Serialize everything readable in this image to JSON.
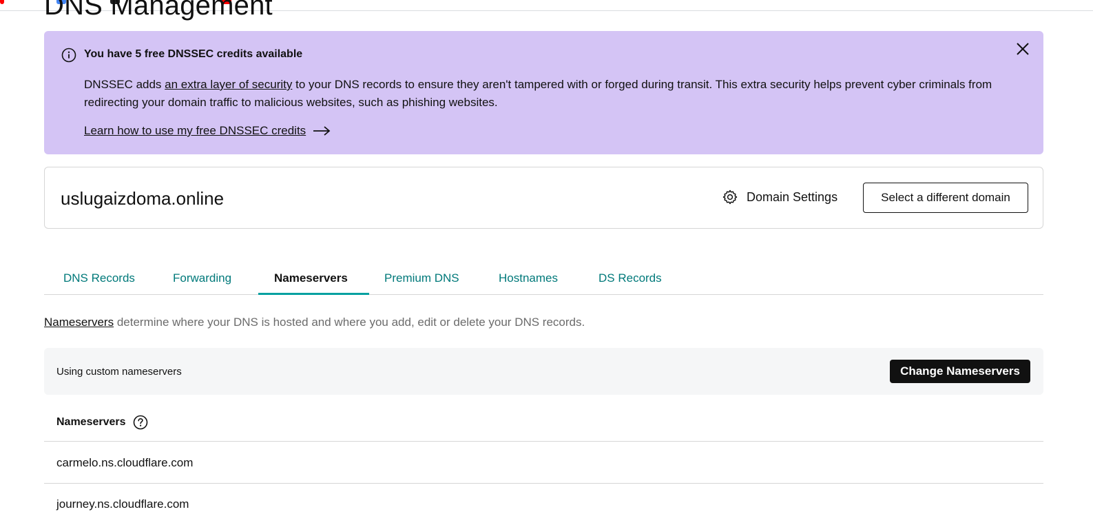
{
  "page": {
    "title": "DNS Management"
  },
  "banner": {
    "title": "You have 5 free DNSSEC credits available",
    "body_prefix": "DNSSEC adds ",
    "body_link": "an extra layer of security",
    "body_suffix": " to your DNS records to ensure they aren't tampered with or forged during transit. This extra security helps prevent cyber criminals from redirecting your domain traffic to malicious websites, such as phishing websites.",
    "cta": "Learn how to use my free DNSSEC credits",
    "background_color": "#d4c4f5"
  },
  "domain": {
    "name": "uslugaizdoma.online",
    "settings_label": "Domain Settings",
    "select_label": "Select a different domain"
  },
  "tabs": [
    {
      "label": "DNS Records",
      "active": false
    },
    {
      "label": "Forwarding",
      "active": false
    },
    {
      "label": "Nameservers",
      "active": true
    },
    {
      "label": "Premium DNS",
      "active": false
    },
    {
      "label": "Hostnames",
      "active": false
    },
    {
      "label": "DS Records",
      "active": false
    }
  ],
  "nameservers_section": {
    "desc_link": "Nameservers",
    "desc_text": " determine where your DNS is hosted and where you add, edit or delete your DNS records.",
    "status_text": "Using custom nameservers",
    "change_button": "Change Nameservers",
    "list_header": "Nameservers",
    "items": [
      "carmelo.ns.cloudflare.com",
      "journey.ns.cloudflare.com"
    ]
  },
  "colors": {
    "accent_teal": "#00797a",
    "tab_underline": "#00a0a0",
    "primary_button": "#111111"
  }
}
